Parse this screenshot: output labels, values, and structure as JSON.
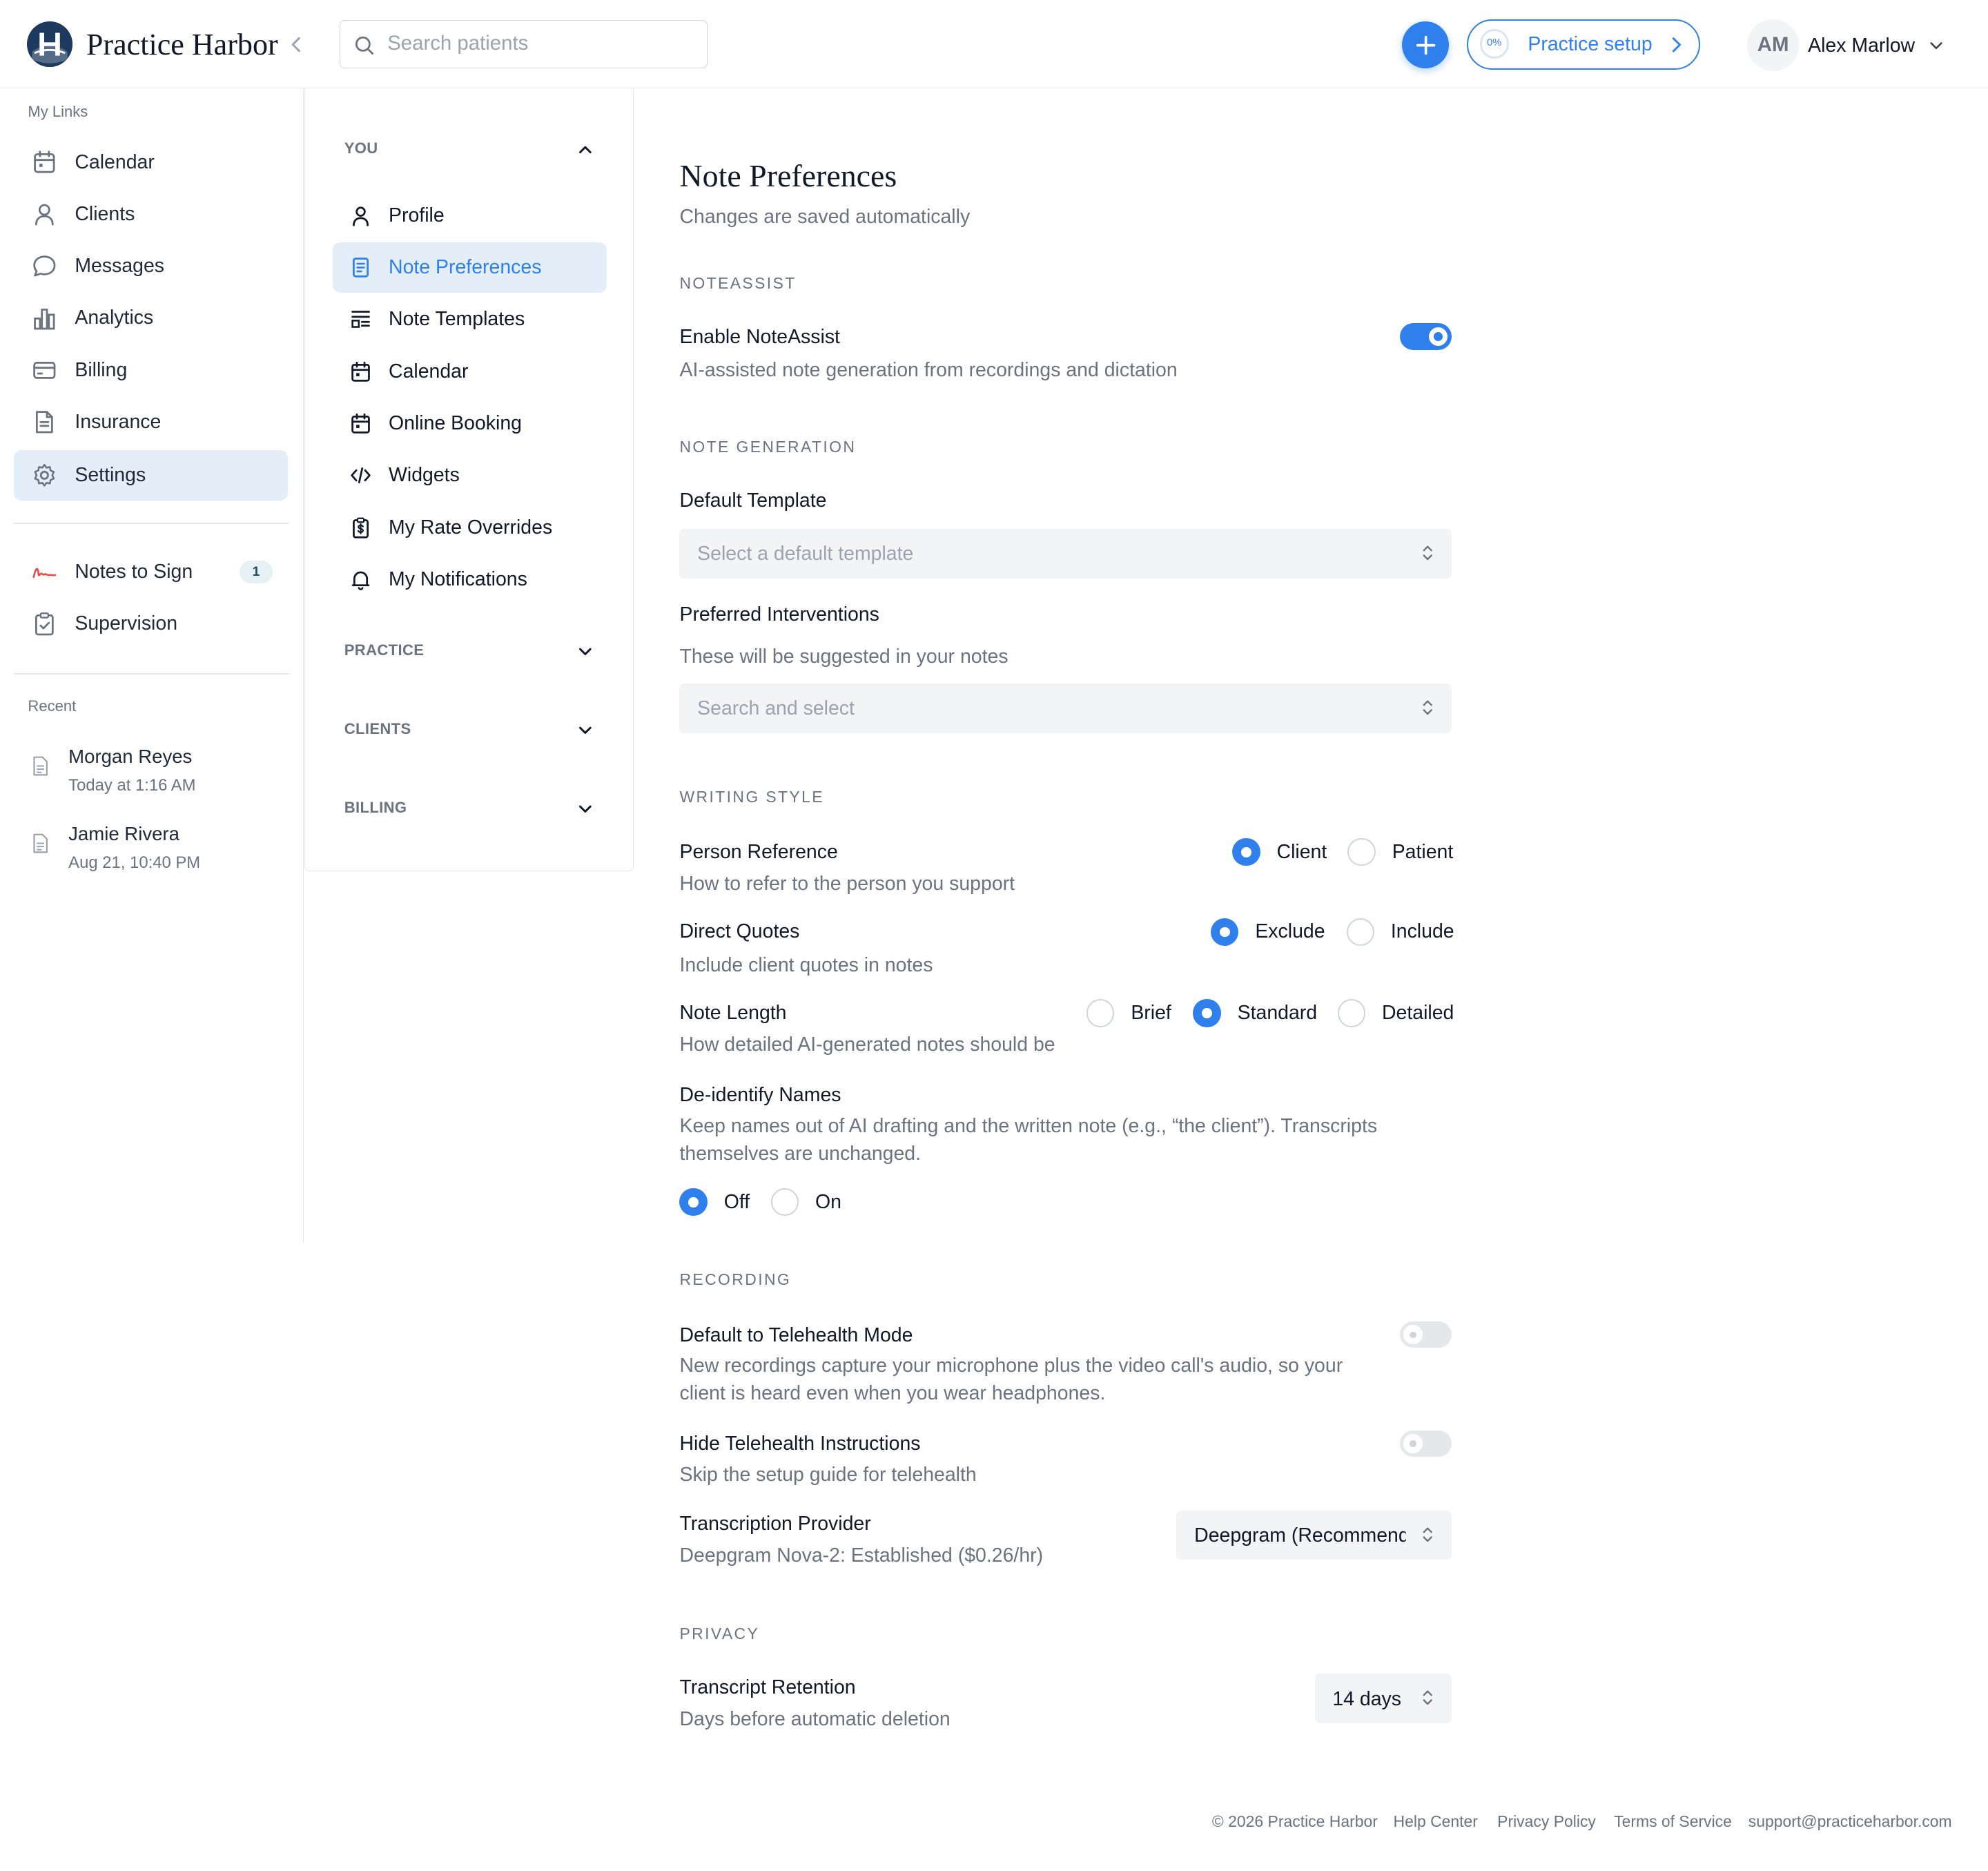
{
  "header": {
    "brand": "Practice Harbor",
    "search_placeholder": "Search patients",
    "setup_progress": "0%",
    "setup_label": "Practice setup",
    "user_initials": "AM",
    "user_name": "Alex Marlow"
  },
  "sidebar": {
    "links_label": "My Links",
    "items": [
      {
        "label": "Calendar",
        "icon": "calendar-icon"
      },
      {
        "label": "Clients",
        "icon": "user-icon"
      },
      {
        "label": "Messages",
        "icon": "message-icon"
      },
      {
        "label": "Analytics",
        "icon": "bar-chart-icon"
      },
      {
        "label": "Billing",
        "icon": "credit-card-icon"
      },
      {
        "label": "Insurance",
        "icon": "document-icon"
      },
      {
        "label": "Settings",
        "icon": "gear-icon",
        "active": true
      }
    ],
    "extra": [
      {
        "label": "Notes to Sign",
        "icon": "signature-icon",
        "badge": "1"
      },
      {
        "label": "Supervision",
        "icon": "clipboard-check-icon"
      }
    ],
    "recent_label": "Recent",
    "recent": [
      {
        "name": "Morgan Reyes",
        "time": "Today at 1:16 AM"
      },
      {
        "name": "Jamie Rivera",
        "time": "Aug 21, 10:40 PM"
      }
    ]
  },
  "settings_nav": {
    "you_label": "YOU",
    "you_items": [
      {
        "label": "Profile",
        "icon": "user-icon"
      },
      {
        "label": "Note Preferences",
        "icon": "note-icon",
        "active": true
      },
      {
        "label": "Note Templates",
        "icon": "template-icon"
      },
      {
        "label": "Calendar",
        "icon": "calendar-icon"
      },
      {
        "label": "Online Booking",
        "icon": "calendar-icon"
      },
      {
        "label": "Widgets",
        "icon": "code-icon"
      },
      {
        "label": "My Rate Overrides",
        "icon": "dollar-icon"
      },
      {
        "label": "My Notifications",
        "icon": "bell-icon"
      }
    ],
    "groups": [
      "PRACTICE",
      "CLIENTS",
      "BILLING"
    ]
  },
  "main": {
    "title": "Note Preferences",
    "subtitle": "Changes are saved automatically",
    "noteassist": {
      "section": "NOTEASSIST",
      "enable_label": "Enable NoteAssist",
      "enable_desc": "AI-assisted note generation from recordings and dictation",
      "enabled": true
    },
    "generation": {
      "section": "NOTE GENERATION",
      "template_label": "Default Template",
      "template_placeholder": "Select a default template",
      "interventions_label": "Preferred Interventions",
      "interventions_desc": "These will be suggested in your notes",
      "interventions_placeholder": "Search and select"
    },
    "writing": {
      "section": "WRITING STYLE",
      "person_label": "Person Reference",
      "person_desc": "How to refer to the person you support",
      "person_options": [
        "Client",
        "Patient"
      ],
      "person_selected": "Client",
      "quotes_label": "Direct Quotes",
      "quotes_desc": "Include client quotes in notes",
      "quotes_options": [
        "Exclude",
        "Include"
      ],
      "quotes_selected": "Exclude",
      "length_label": "Note Length",
      "length_desc": "How detailed AI-generated notes should be",
      "length_options": [
        "Brief",
        "Standard",
        "Detailed"
      ],
      "length_selected": "Standard",
      "deid_label": "De-identify Names",
      "deid_desc": "Keep names out of AI drafting and the written note (e.g., “the client”). Transcripts themselves are unchanged.",
      "deid_options": [
        "Off",
        "On"
      ],
      "deid_selected": "Off"
    },
    "recording": {
      "section": "RECORDING",
      "telehealth_label": "Default to Telehealth Mode",
      "telehealth_desc": "New recordings capture your microphone plus the video call's audio, so your client is heard even when you wear headphones.",
      "telehealth_enabled": false,
      "hide_label": "Hide Telehealth Instructions",
      "hide_desc": "Skip the setup guide for telehealth",
      "hide_enabled": false,
      "provider_label": "Transcription Provider",
      "provider_desc": "Deepgram Nova-2: Established ($0.26/hr)",
      "provider_value": "Deepgram (Recommended)"
    },
    "privacy": {
      "section": "PRIVACY",
      "retention_label": "Transcript Retention",
      "retention_desc": "Days before automatic deletion",
      "retention_value": "14 days"
    }
  },
  "footer": {
    "copyright": "© 2026 Practice Harbor",
    "links": [
      "Help Center",
      "Privacy Policy",
      "Terms of Service",
      "support@practiceharbor.com"
    ]
  },
  "colors": {
    "accent": "#2f80ed",
    "active_bg": "#e4eef9",
    "brand_navy": "#1e3a5f"
  }
}
